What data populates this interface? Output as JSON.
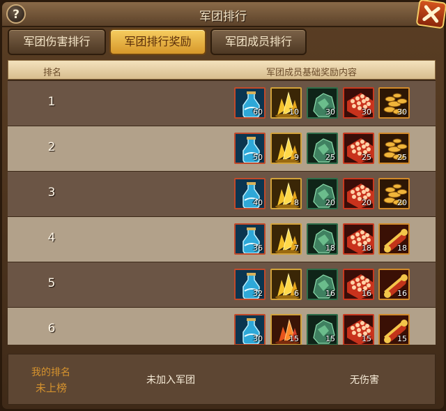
{
  "window": {
    "title": "军团排行",
    "help_label": "?"
  },
  "tabs": [
    {
      "label": "军团伤害排行",
      "active": false
    },
    {
      "label": "军团排行奖励",
      "active": true
    },
    {
      "label": "军团成员排行",
      "active": false
    }
  ],
  "table": {
    "col_rank": "排名",
    "col_reward": "军团成员基础奖励内容",
    "rows": [
      {
        "rank": "1",
        "items": [
          "60",
          "10",
          "30",
          "30",
          "30"
        ]
      },
      {
        "rank": "2",
        "items": [
          "50",
          "9",
          "25",
          "25",
          "25"
        ]
      },
      {
        "rank": "3",
        "items": [
          "40",
          "8",
          "20",
          "20",
          "20"
        ]
      },
      {
        "rank": "4",
        "items": [
          "36",
          "7",
          "18",
          "18",
          "18"
        ]
      },
      {
        "rank": "5",
        "items": [
          "32",
          "6",
          "16",
          "16",
          "16"
        ]
      },
      {
        "rank": "6",
        "items": [
          "30",
          "15",
          "15",
          "15",
          "15"
        ]
      }
    ]
  },
  "footer": {
    "my_rank_label": "我的排名",
    "my_rank_value": "未上榜",
    "legion_status": "未加入军团",
    "damage_status": "无伤害"
  },
  "item_icons": [
    "blue-potion-icon",
    "gold-crystal-icon",
    "green-ore-icon",
    "red-gem-crate-icon",
    "gold-coin-pile-icon"
  ],
  "colors": {
    "accent_gold": "#f6cd60",
    "close_red": "#d3541d",
    "rank_label": "#d5922e"
  }
}
